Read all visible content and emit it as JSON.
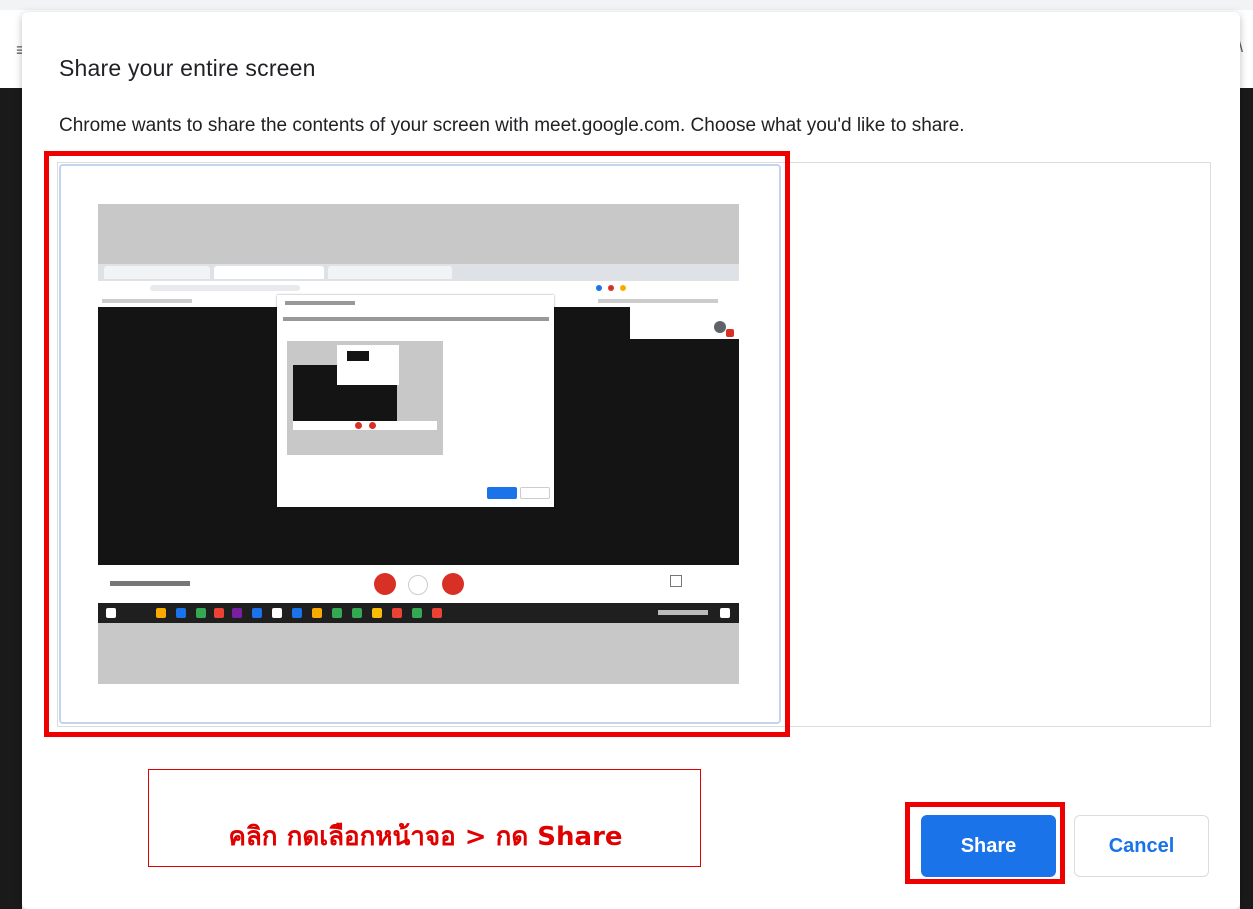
{
  "dialog": {
    "title": "Share your entire screen",
    "subtitle": "Chrome wants to share the contents of your screen with meet.google.com. Choose what you'd like to share."
  },
  "buttons": {
    "share_label": "Share",
    "cancel_label": "Cancel"
  },
  "annotation": {
    "text": "คลิก กดเลือกหน้าจอ > กด Share",
    "color": "#e00000"
  },
  "colors": {
    "accent": "#1a73e8",
    "highlight": "#ef0000"
  }
}
